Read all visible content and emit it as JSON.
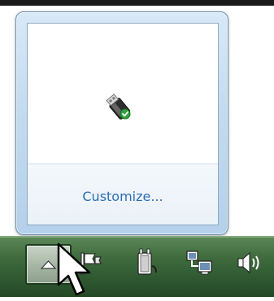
{
  "flyout": {
    "tray_icons": [
      "usb-drive-icon"
    ],
    "customize_label": "Customize..."
  },
  "taskbar": {
    "show_hidden_icons_button": "chevron-up-icon",
    "tray_icons": [
      "action-center-flag-icon",
      "power-plug-icon",
      "network-icon",
      "speaker-volume-icon"
    ]
  },
  "colors": {
    "link": "#2a6fb5",
    "taskbar": "#3f6b3e",
    "flyout_border": "#6d8fae"
  }
}
